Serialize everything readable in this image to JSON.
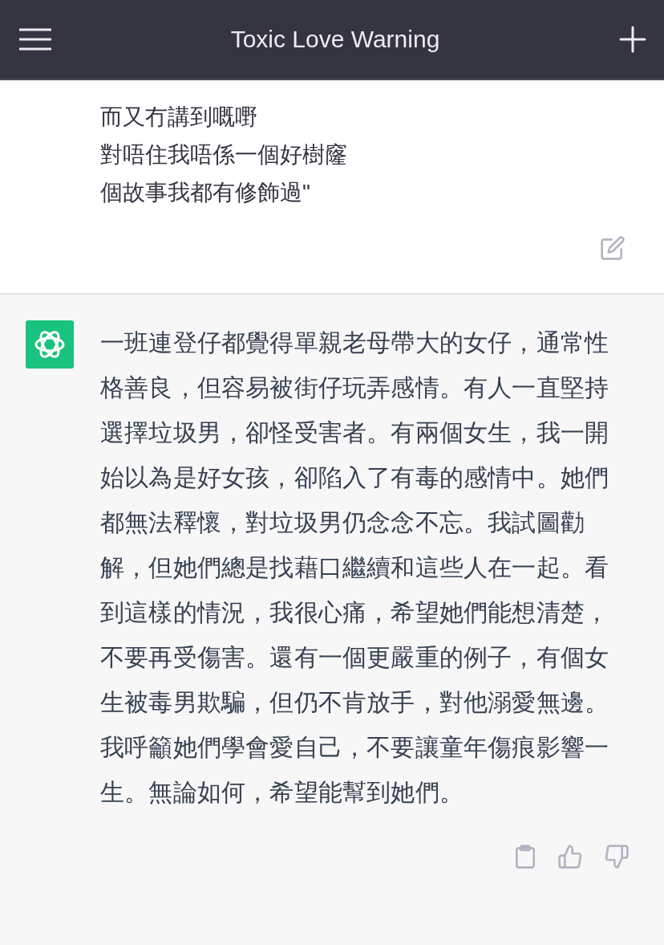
{
  "header": {
    "title": "Toxic Love Warning"
  },
  "user_message": {
    "lines": [
      "而又冇講到嘅嘢",
      "對唔住我唔係一個好樹窿",
      "個故事我都有修飾過\""
    ]
  },
  "assistant_message": {
    "text": "一班連登仔都覺得單親老母帶大的女仔，通常性格善良，但容易被街仔玩弄感情。有人一直堅持選擇垃圾男，卻怪受害者。有兩個女生，我一開始以為是好女孩，卻陷入了有毒的感情中。她們都無法釋懷，對垃圾男仍念念不忘。我試圖勸解，但她們總是找藉口繼續和這些人在一起。看到這樣的情況，我很心痛，希望她們能想清楚，不要再受傷害。還有一個更嚴重的例子，有個女生被毒男欺騙，但仍不肯放手，對他溺愛無邊。我呼籲她們學會愛自己，不要讓童年傷痕影響一生。無論如何，希望能幫到她們。"
  }
}
